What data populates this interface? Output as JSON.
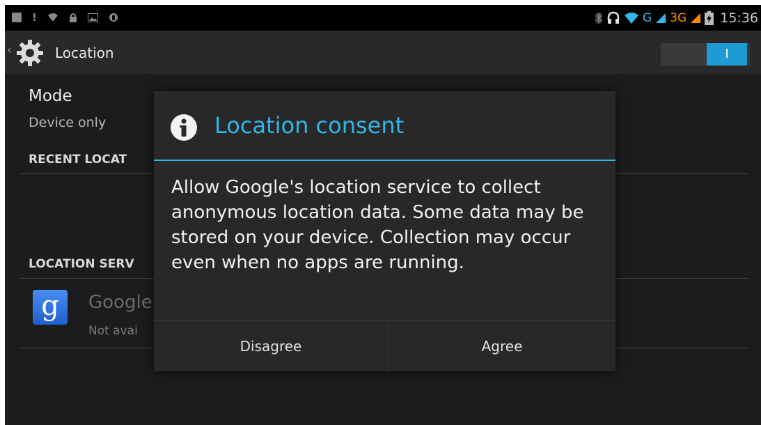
{
  "status_bar": {
    "time": "15:36",
    "network_g": "G",
    "network_3g": "3G",
    "left_icons": [
      "message-icon",
      "alert-icon",
      "wifi-icon",
      "lock-icon",
      "image-icon",
      "android-icon"
    ],
    "right_icons": [
      "bluetooth-icon",
      "headset-icon",
      "wifi-icon",
      "signal-icon",
      "signal-icon",
      "battery-icon"
    ]
  },
  "action_bar": {
    "title": "Location",
    "up_glyph": "‹",
    "icon": "settings-gear-icon",
    "switch_on_label": "I"
  },
  "settings": {
    "mode_title": "Mode",
    "mode_value": "Device only",
    "recent_header": "RECENT LOCAT",
    "services_header": "LOCATION SERV",
    "service_item": {
      "icon": "google-search-icon",
      "icon_letter": "g",
      "title": "Google",
      "subtitle": "Not avai"
    }
  },
  "dialog": {
    "title": "Location consent",
    "icon": "info-icon",
    "message": "Allow Google's location service to collect anonymous location data. Some data may be stored on your device. Collection may occur even when no apps are running.",
    "buttons": {
      "disagree": "Disagree",
      "agree": "Agree"
    }
  },
  "colors": {
    "accent": "#33b5e5",
    "switch_on": "#1f9bd4",
    "background": "#1b1c1d",
    "dialog_bg": "#282828"
  }
}
